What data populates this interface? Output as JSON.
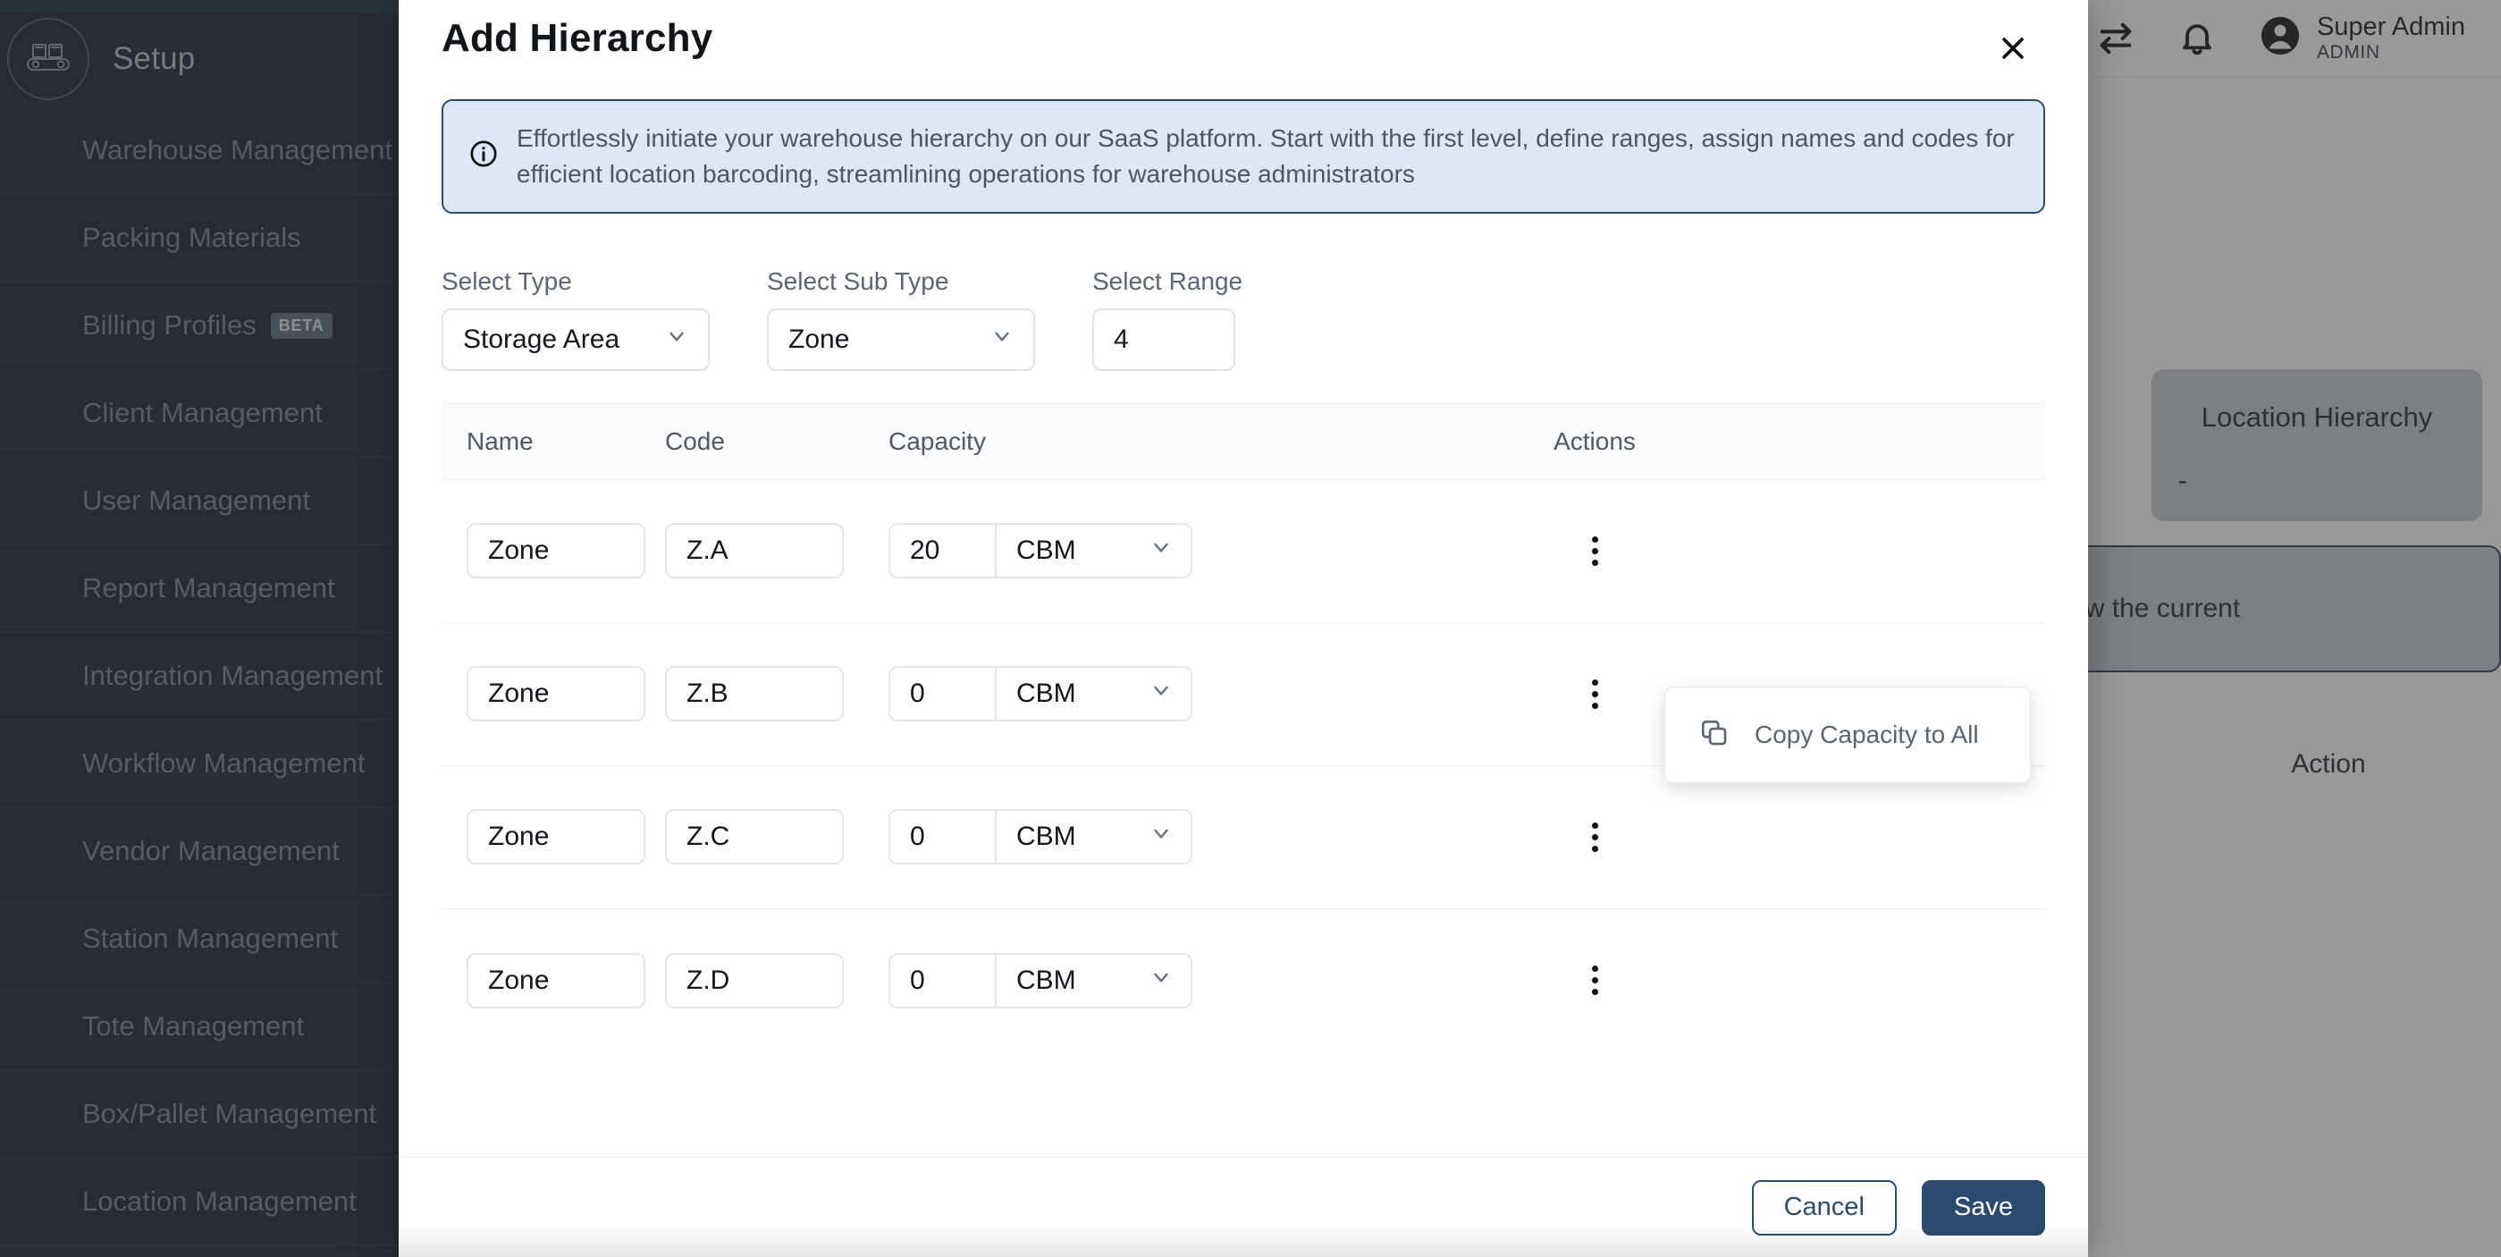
{
  "sidebar": {
    "brand_title": "Setup",
    "brand_icon": "conveyor-belt-icon",
    "items": [
      {
        "label": "Warehouse Management",
        "badge": ""
      },
      {
        "label": "Packing Materials",
        "badge": ""
      },
      {
        "label": "Billing Profiles",
        "badge": "BETA"
      },
      {
        "label": "Client Management",
        "badge": ""
      },
      {
        "label": "User Management",
        "badge": ""
      },
      {
        "label": "Report Management",
        "badge": ""
      },
      {
        "label": "Integration Management",
        "badge": ""
      },
      {
        "label": "Workflow Management",
        "badge": ""
      },
      {
        "label": "Vendor Management",
        "badge": ""
      },
      {
        "label": "Station Management",
        "badge": ""
      },
      {
        "label": "Tote Management",
        "badge": ""
      },
      {
        "label": "Box/Pallet Management",
        "badge": ""
      },
      {
        "label": "Location Management",
        "badge": ""
      }
    ]
  },
  "topbar": {
    "swap_icon": "swap-arrows-icon",
    "notification_icon": "bell-icon",
    "avatar_icon": "user-avatar-icon",
    "user_name": "Super Admin",
    "user_role": "ADMIN"
  },
  "background": {
    "hierarchy_card_title": "Location Hierarchy",
    "hierarchy_card_value": "-",
    "description_text": "level below the current",
    "action_label": "Action"
  },
  "modal": {
    "title": "Add Hierarchy",
    "close_icon": "close-icon",
    "info_icon": "info-circle-icon",
    "info_text": "Effortlessly initiate your warehouse hierarchy on our SaaS platform. Start with the first level, define ranges, assign names and codes for efficient location barcoding, streamlining operations for warehouse administrators",
    "form": {
      "type_label": "Select Type",
      "type_value": "Storage Area",
      "subtype_label": "Select Sub Type",
      "subtype_value": "Zone",
      "range_label": "Select Range",
      "range_value": "4"
    },
    "table": {
      "headers": [
        "Name",
        "Code",
        "Capacity",
        "Actions"
      ],
      "rows": [
        {
          "name": "Zone",
          "code": "Z.A",
          "capacity": "20",
          "unit": "CBM",
          "actions_icon": "kebab-menu-icon"
        },
        {
          "name": "Zone",
          "code": "Z.B",
          "capacity": "0",
          "unit": "CBM",
          "actions_icon": "kebab-menu-icon"
        },
        {
          "name": "Zone",
          "code": "Z.C",
          "capacity": "0",
          "unit": "CBM",
          "actions_icon": "kebab-menu-icon"
        },
        {
          "name": "Zone",
          "code": "Z.D",
          "capacity": "0",
          "unit": "CBM",
          "actions_icon": "kebab-menu-icon"
        }
      ]
    },
    "context_menu": {
      "icon": "copy-icon",
      "label": "Copy Capacity to All"
    },
    "footer": {
      "cancel_label": "Cancel",
      "save_label": "Save"
    }
  },
  "colors": {
    "sidebar_bg": "#141e2c",
    "accent_navy": "#2c4a6e",
    "banner_bg": "#dbe8f8",
    "banner_border": "#2b4a73"
  }
}
